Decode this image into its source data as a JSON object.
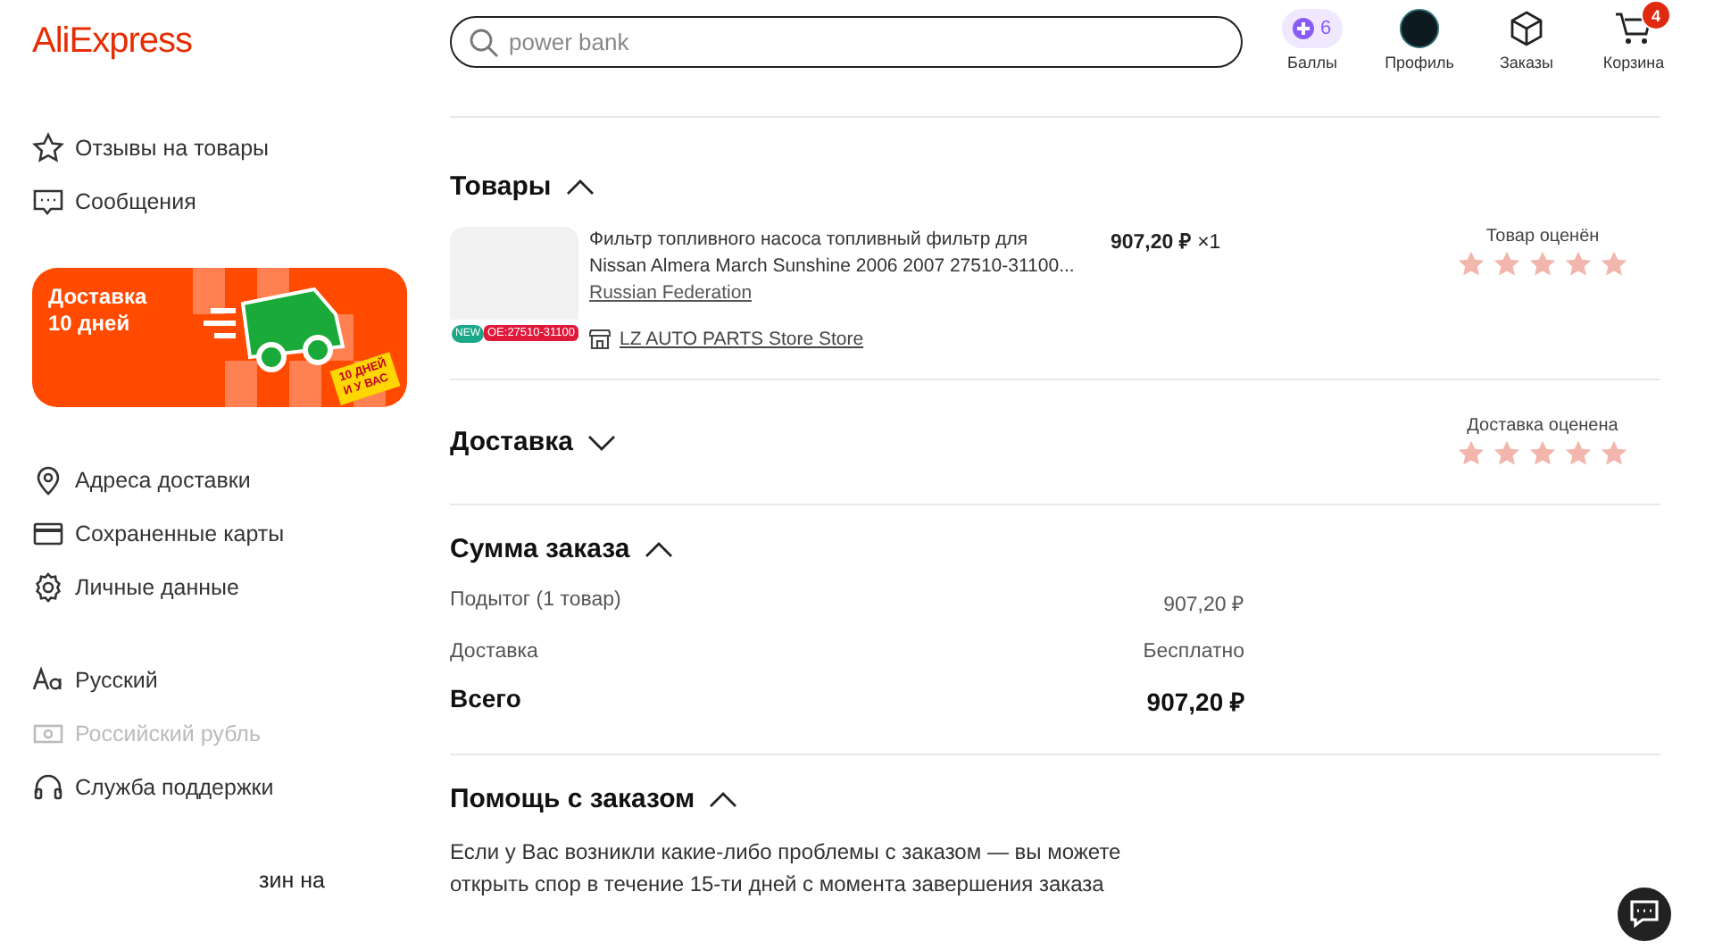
{
  "logo": "AliExpress",
  "sidebar": {
    "items": [
      {
        "label": "Отзывы на товары",
        "disabled": false
      },
      {
        "label": "Сообщения",
        "disabled": false
      }
    ],
    "banner": {
      "title": "Доставка\n10 дней",
      "tag": "10 ДНЕЙ\nИ У ВАС"
    },
    "items_2": [
      {
        "label": "Адреса доставки",
        "disabled": false
      },
      {
        "label": "Сохраненные карты",
        "disabled": false
      },
      {
        "label": "Личные данные",
        "disabled": false
      }
    ],
    "items_3": [
      {
        "label": "Русский",
        "disabled": false
      },
      {
        "label": "Российский рубль",
        "disabled": true
      },
      {
        "label": "Служба поддержки",
        "disabled": false
      }
    ],
    "fragment": "зин на"
  },
  "search": {
    "placeholder": "power bank"
  },
  "header_actions": [
    {
      "kind": "points",
      "label": "Баллы",
      "count": "6"
    },
    {
      "kind": "profile",
      "label": "Профиль"
    },
    {
      "kind": "orders",
      "label": "Заказы"
    },
    {
      "kind": "cart",
      "label": "Корзина",
      "count": "4"
    }
  ],
  "sections": [
    {
      "kind": "items",
      "title": "Товары",
      "expanded": true,
      "product": {
        "title": "Фильтр топливного насоса топливный фильтр для Nissan Almera March Sunshine 2006 2007 27510-31100...",
        "origin": "Russian Federation",
        "store": "LZ AUTO PARTS Store Store",
        "price": "**907,20 ₽** ×1",
        "image_label": "OE:27510-31100",
        "image_badge": "NEW"
      },
      "rating": {
        "label": "Товар оценён",
        "stars": 5
      }
    },
    {
      "kind": "delivery",
      "title": "Доставка",
      "expanded": false,
      "rating": {
        "label": "Доставка оценена",
        "stars": 5
      }
    },
    {
      "kind": "summary",
      "title": "Сумма заказа",
      "expanded": true,
      "rows": [
        {
          "label": "Подытог (1 товар)",
          "value": "907,20 ₽",
          "total": false
        },
        {
          "label": "Доставка",
          "value": "Бесплатно",
          "total": false
        },
        {
          "label": "Всего",
          "value": "907,20 ₽",
          "total": true
        }
      ]
    },
    {
      "kind": "help",
      "title": "Помощь с заказом",
      "expanded": true,
      "text": "Если у Вас возникли какие-либо проблемы с заказом — вы можете открыть спор в течение 15-ти дней с момента завершения заказа"
    }
  ]
}
